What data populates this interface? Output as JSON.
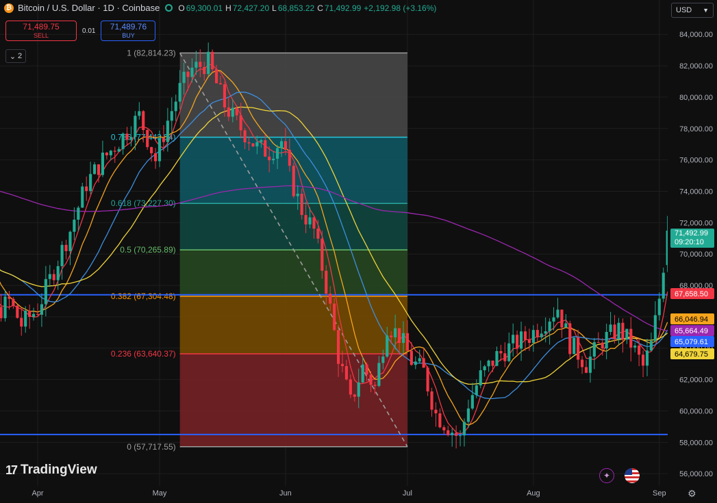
{
  "header": {
    "title": "Bitcoin / U.S. Dollar · 1D · Coinbase",
    "coin_glyph": "₿",
    "ohlc": [
      {
        "k": "O",
        "v": "69,300.01"
      },
      {
        "k": "H",
        "v": "72,427.20"
      },
      {
        "k": "L",
        "v": "68,853.22"
      },
      {
        "k": "C",
        "v": "71,492.99"
      }
    ],
    "change": "+2,192.98 (+3.16%)"
  },
  "trade": {
    "sell_price": "71,489.75",
    "sell_label": "SELL",
    "spread": "0.01",
    "buy_price": "71,489.76",
    "buy_label": "BUY"
  },
  "indicators_toggle": {
    "count": "2",
    "icon": "chevron-down-icon"
  },
  "currency_select": {
    "value": "USD"
  },
  "brand": {
    "name": "TradingView",
    "mark": "17"
  },
  "colors": {
    "up": "#22ab94",
    "down": "#f23645",
    "background": "#0f0f0f",
    "ma_fast": "#f23645",
    "ma_2": "#f7a51c",
    "ma_3": "#3d8fe0",
    "ma_4": "#f0d43a",
    "ma_slow": "#9c27b0",
    "hline": "#2962ff"
  },
  "chart_data": {
    "type": "candlestick",
    "symbol": "Bitcoin / U.S. Dollar",
    "interval": "1D",
    "exchange": "Coinbase",
    "ylim": [
      55000,
      86000
    ],
    "y_ticks": [
      56000,
      58000,
      60000,
      62000,
      64000,
      66000,
      68000,
      70000,
      72000,
      74000,
      76000,
      78000,
      80000,
      82000,
      84000
    ],
    "y_tick_labels": [
      "56,000.00",
      "58,000.00",
      "60,000.00",
      "62,000.00",
      "64,000.00",
      "66,000.00",
      "68,000.00",
      "70,000.00",
      "72,000.00",
      "74,000.00",
      "76,000.00",
      "78,000.00",
      "80,000.00",
      "82,000.00",
      "84,000.00"
    ],
    "x_ticks": [
      "2024-04-01",
      "2024-05-01",
      "2024-06-01",
      "2024-07-01",
      "2024-08-01",
      "2024-09-01"
    ],
    "x_tick_labels": [
      "Apr",
      "May",
      "Jun",
      "Jul",
      "Aug",
      "Sep"
    ],
    "x_range": [
      "2024-03-08",
      "2024-09-16"
    ],
    "grid": true,
    "fibonacci": {
      "start": {
        "date": "2024-05-06",
        "price": 82814.23
      },
      "end": {
        "date": "2024-07-01",
        "price": 57717.55
      },
      "levels": [
        {
          "ratio": 1,
          "price": 82814.23,
          "label": "1 (82,814.23)",
          "color": "#9e9e9e",
          "fill": "#4a4a4a"
        },
        {
          "ratio": 0.786,
          "price": 77443.54,
          "label": "0.786 (77,443.54)",
          "color": "#26c6da",
          "fill": "#0f5a66"
        },
        {
          "ratio": 0.618,
          "price": 73227.3,
          "label": "0.618 (73,227.30)",
          "color": "#26a69a",
          "fill": "#0f4a42"
        },
        {
          "ratio": 0.5,
          "price": 70265.89,
          "label": "0.5 (70,265.89)",
          "color": "#66bb6a",
          "fill": "#284a22"
        },
        {
          "ratio": 0.382,
          "price": 67304.48,
          "label": "0.382 (67,304.48)",
          "color": "#ff9800",
          "fill": "#7a4e00"
        },
        {
          "ratio": 0.236,
          "price": 63640.37,
          "label": "0.236 (63,640.37)",
          "color": "#f23645",
          "fill": "#7a2226"
        },
        {
          "ratio": 0,
          "price": 57717.55,
          "label": "0 (57,717.55)",
          "color": "#9e9e9e",
          "fill": "#7a2226"
        }
      ]
    },
    "horizontal_lines": [
      {
        "price": 67400,
        "color": "#2962ff"
      },
      {
        "price": 58500,
        "color": "#2962ff"
      }
    ],
    "price_labels": [
      {
        "price": 71492.99,
        "text": "71,492.99",
        "subtext": "09:20:10",
        "color": "#22ab94"
      },
      {
        "price": 67658.5,
        "text": "67,658.50",
        "color": "#f23645"
      },
      {
        "price": 66046.94,
        "text": "66,046.94",
        "color": "#f7a51c"
      },
      {
        "price": 65664.49,
        "text": "65,664.49",
        "color": "#9c27b0"
      },
      {
        "price": 65079.61,
        "text": "65,079.61",
        "color": "#2962ff"
      },
      {
        "price": 64679.75,
        "text": "64,679.75",
        "color": "#f0d43a"
      }
    ],
    "close_anchors": [
      {
        "date": "2024-03-09",
        "close": 70500
      },
      {
        "date": "2024-03-14",
        "close": 71500
      },
      {
        "date": "2024-03-18",
        "close": 68000
      },
      {
        "date": "2024-03-21",
        "close": 66000
      },
      {
        "date": "2024-03-25",
        "close": 67000
      },
      {
        "date": "2024-03-28",
        "close": 65500
      },
      {
        "date": "2024-04-01",
        "close": 66500
      },
      {
        "date": "2024-04-05",
        "close": 69000
      },
      {
        "date": "2024-04-09",
        "close": 71500
      },
      {
        "date": "2024-04-13",
        "close": 74500
      },
      {
        "date": "2024-04-17",
        "close": 76000
      },
      {
        "date": "2024-04-22",
        "close": 77500
      },
      {
        "date": "2024-04-26",
        "close": 78800
      },
      {
        "date": "2024-04-30",
        "close": 76000
      },
      {
        "date": "2024-05-03",
        "close": 78500
      },
      {
        "date": "2024-05-06",
        "close": 80500
      },
      {
        "date": "2024-05-09",
        "close": 81800
      },
      {
        "date": "2024-05-13",
        "close": 82200
      },
      {
        "date": "2024-05-17",
        "close": 79500
      },
      {
        "date": "2024-05-21",
        "close": 78000
      },
      {
        "date": "2024-05-25",
        "close": 76800
      },
      {
        "date": "2024-05-28",
        "close": 76500
      },
      {
        "date": "2024-05-31",
        "close": 77200
      },
      {
        "date": "2024-06-02",
        "close": 75000
      },
      {
        "date": "2024-06-05",
        "close": 72800
      },
      {
        "date": "2024-06-08",
        "close": 71500
      },
      {
        "date": "2024-06-11",
        "close": 68000
      },
      {
        "date": "2024-06-14",
        "close": 63500
      },
      {
        "date": "2024-06-17",
        "close": 60500
      },
      {
        "date": "2024-06-20",
        "close": 62800
      },
      {
        "date": "2024-06-23",
        "close": 61500
      },
      {
        "date": "2024-06-26",
        "close": 65500
      },
      {
        "date": "2024-06-29",
        "close": 64800
      },
      {
        "date": "2024-07-02",
        "close": 63200
      },
      {
        "date": "2024-07-05",
        "close": 62500
      },
      {
        "date": "2024-07-08",
        "close": 59800
      },
      {
        "date": "2024-07-11",
        "close": 59000
      },
      {
        "date": "2024-07-14",
        "close": 58200
      },
      {
        "date": "2024-07-16",
        "close": 60500
      },
      {
        "date": "2024-07-19",
        "close": 62200
      },
      {
        "date": "2024-07-23",
        "close": 63500
      },
      {
        "date": "2024-07-27",
        "close": 64200
      },
      {
        "date": "2024-07-31",
        "close": 64800
      },
      {
        "date": "2024-08-03",
        "close": 65500
      },
      {
        "date": "2024-08-07",
        "close": 66600
      },
      {
        "date": "2024-08-10",
        "close": 64300
      },
      {
        "date": "2024-08-14",
        "close": 63000
      },
      {
        "date": "2024-08-18",
        "close": 64500
      },
      {
        "date": "2024-08-22",
        "close": 65200
      },
      {
        "date": "2024-08-25",
        "close": 64300
      },
      {
        "date": "2024-08-28",
        "close": 62800
      },
      {
        "date": "2024-08-30",
        "close": 64200
      },
      {
        "date": "2024-09-01",
        "close": 67200
      },
      {
        "date": "2024-09-02",
        "close": 69300
      },
      {
        "date": "2024-09-03",
        "close": 71492.99
      }
    ],
    "moving_averages": [
      {
        "color": "#f23645",
        "period": 5
      },
      {
        "color": "#f7a51c",
        "period": 10
      },
      {
        "color": "#3d8fe0",
        "period": 20
      },
      {
        "color": "#f0d43a",
        "period": 30
      },
      {
        "color": "#9c27b0",
        "period": 100,
        "start": 74800
      }
    ]
  }
}
